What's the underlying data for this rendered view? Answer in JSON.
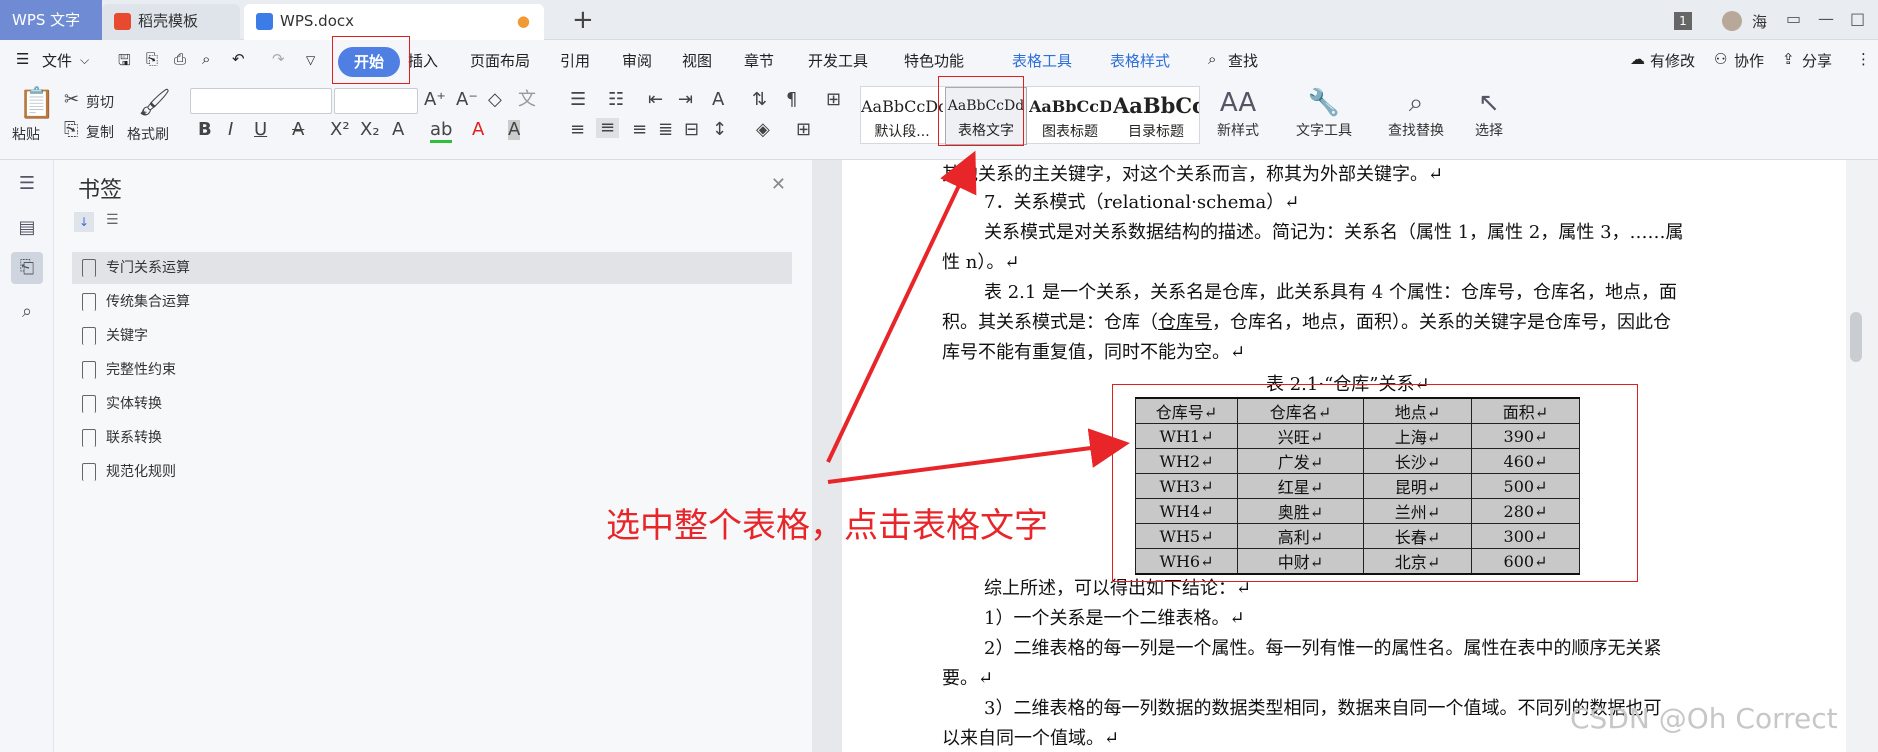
{
  "tabs": {
    "app": "WPS 文字",
    "template": "稻壳模板",
    "doc": "WPS.docx",
    "plus": "+"
  },
  "user": {
    "badge": "1",
    "name": "海"
  },
  "menu": {
    "file": "文件",
    "items": [
      "开始",
      "插入",
      "页面布局",
      "引用",
      "审阅",
      "视图",
      "章节",
      "开发工具",
      "特色功能"
    ],
    "context": [
      "表格工具",
      "表格样式"
    ],
    "search": "查找",
    "right": [
      "有修改",
      "协作",
      "分享"
    ]
  },
  "ribbon": {
    "paste": "粘贴",
    "cut": "剪切",
    "copy": "复制",
    "painter": "格式刷",
    "styles": [
      {
        "preview": "AaBbCcDd",
        "name": "默认段..."
      },
      {
        "preview": "AaBbCcDd",
        "name": "表格文字"
      },
      {
        "preview": "AaBbCcDd",
        "name": "图表标题"
      },
      {
        "preview": "AaBbCc",
        "name": "目录标题"
      }
    ],
    "new_style": "新样式",
    "text_tool": "文字工具",
    "find_replace": "查找替换",
    "select": "选择"
  },
  "bookmarks": {
    "title": "书签",
    "items": [
      "专门关系运算",
      "传统集合运算",
      "关键字",
      "完整性约束",
      "实体转换",
      "联系转换",
      "规范化规则"
    ]
  },
  "doc": {
    "l1": "其他关系的主关键字，对这个关系而言，称其为外部关键字。↵",
    "l2": "7．关系模式（relational·schema）↵",
    "l3": "关系模式是对关系数据结构的描述。简记为：关系名（属性 1，属性 2，属性 3，……属",
    "l4": "性 n）。↵",
    "l5": "表 2.1 是一个关系，关系名是仓库，此关系具有 4 个属性：仓库号，仓库名，地点，面",
    "l6a": "积。其关系模式是：仓库（",
    "l6u": "仓库号",
    "l6b": "，仓库名，地点，面积）。关系的关键字是仓库号，因此仓",
    "l7": "库号不能有重复值，同时不能为空。↵",
    "caption": "表 2.1·“仓库”关系↵",
    "table": {
      "headers": [
        "仓库号↵",
        "仓库名↵",
        "地点↵",
        "面积↵"
      ],
      "rows": [
        [
          "WH1↵",
          "兴旺↵",
          "上海↵",
          "390↵"
        ],
        [
          "WH2↵",
          "广发↵",
          "长沙↵",
          "460↵"
        ],
        [
          "WH3↵",
          "红星↵",
          "昆明↵",
          "500↵"
        ],
        [
          "WH4↵",
          "奥胜↵",
          "兰州↵",
          "280↵"
        ],
        [
          "WH5↵",
          "高利↵",
          "长春↵",
          "300↵"
        ],
        [
          "WH6↵",
          "中财↵",
          "北京↵",
          "600↵"
        ]
      ]
    },
    "c1": "综上所述，可以得出如下结论：↵",
    "c2": "1）一个关系是一个二维表格。↵",
    "c3": "2）二维表格的每一列是一个属性。每一列有惟一的属性名。属性在表中的顺序无关紧",
    "c4": "要。↵",
    "c5": "3）二维表格的每一列数据的数据类型相同，数据来自同一个值域。不同列的数据也可",
    "c6": "以来自同一个值域。↵"
  },
  "annotation": "选中整个表格，点击表格文字",
  "watermark": "CSDN @Oh Correct",
  "colors": {
    "accent": "#4f7fe3",
    "annotation": "#e8262a"
  }
}
